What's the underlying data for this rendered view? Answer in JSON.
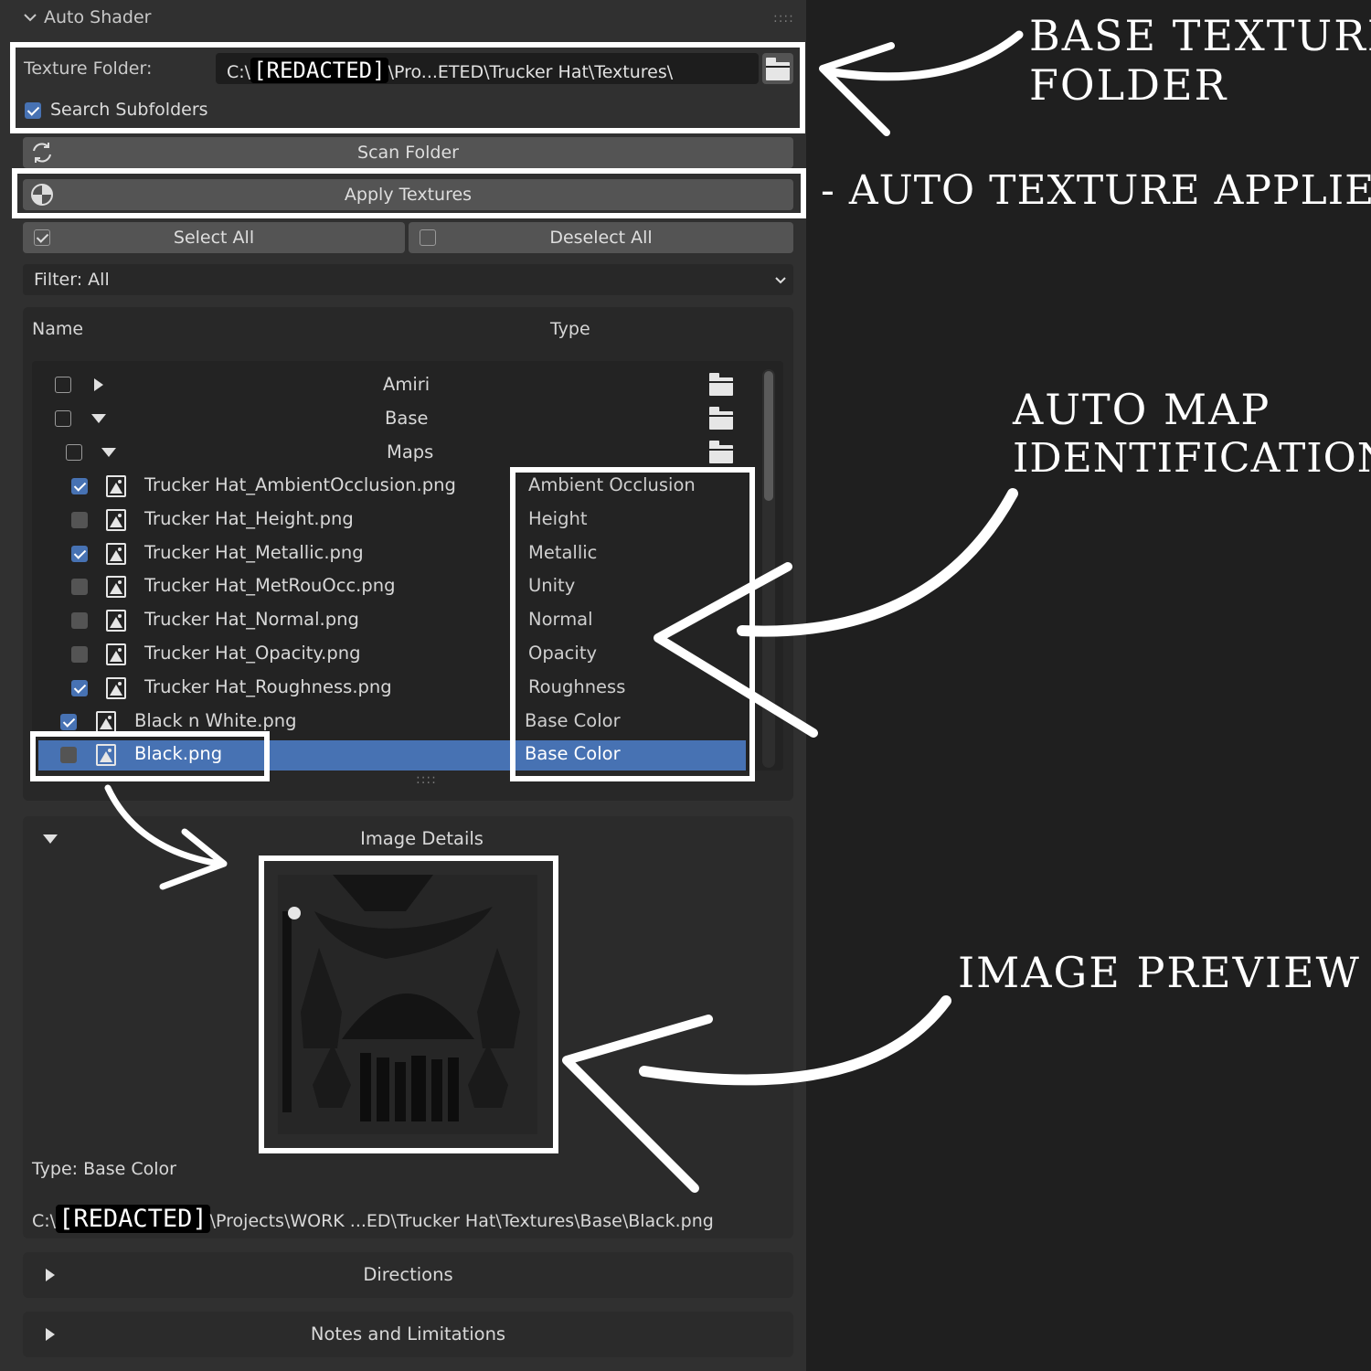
{
  "panel": {
    "title": "Auto Shader",
    "grip": "::::",
    "texture_folder_label": "Texture Folder:",
    "texture_folder_prefix": "C:\\",
    "texture_folder_redacted": "[REDACTED]",
    "texture_folder_suffix": "\\Pro...ETED\\Trucker Hat\\Textures\\",
    "search_subfolders_label": "Search Subfolders",
    "search_subfolders_checked": true,
    "scan_folder_label": "Scan Folder",
    "apply_textures_label": "Apply Textures",
    "select_all_label": "Select All",
    "deselect_all_label": "Deselect All",
    "filter_label": "Filter: All"
  },
  "list": {
    "col_name": "Name",
    "col_type": "Type",
    "folders": [
      {
        "name": "Amiri",
        "expanded": false
      },
      {
        "name": "Base",
        "expanded": true
      },
      {
        "name": "Maps",
        "expanded": true
      }
    ],
    "files": [
      {
        "name": "Trucker Hat_AmbientOcclusion.png",
        "type": "Ambient Occlusion",
        "checked": true
      },
      {
        "name": "Trucker Hat_Height.png",
        "type": "Height",
        "checked": false
      },
      {
        "name": "Trucker Hat_Metallic.png",
        "type": "Metallic",
        "checked": true
      },
      {
        "name": "Trucker Hat_MetRouOcc.png",
        "type": "Unity",
        "checked": false
      },
      {
        "name": "Trucker Hat_Normal.png",
        "type": "Normal",
        "checked": false
      },
      {
        "name": "Trucker Hat_Opacity.png",
        "type": "Opacity",
        "checked": false
      },
      {
        "name": "Trucker Hat_Roughness.png",
        "type": "Roughness",
        "checked": true
      },
      {
        "name": "Black n White.png",
        "type": "Base Color",
        "checked": true
      },
      {
        "name": "Black.png",
        "type": "Base Color",
        "checked": false,
        "selected": true
      }
    ]
  },
  "details": {
    "title": "Image Details",
    "type_line": "Type: Base Color",
    "path_prefix": "C:\\",
    "path_redacted": "[REDACTED]",
    "path_suffix": "\\Projects\\WORK ...ED\\Trucker Hat\\Textures\\Base\\Black.png"
  },
  "sections": {
    "directions": "Directions",
    "notes": "Notes and Limitations"
  },
  "annotations": {
    "base_folder_1": "BASE TEXTURE",
    "base_folder_2": "FOLDER",
    "applier": "- AUTO TEXTURE APPLIER",
    "auto_map_1": "AUTO MAP",
    "auto_map_2": "IDENTIFICATION",
    "preview": "IMAGE PREVIEW"
  },
  "colors": {
    "panel_bg": "#303030",
    "page_bg": "#1f1f1f",
    "accent": "#4772b3",
    "annotation": "#ffffff"
  }
}
